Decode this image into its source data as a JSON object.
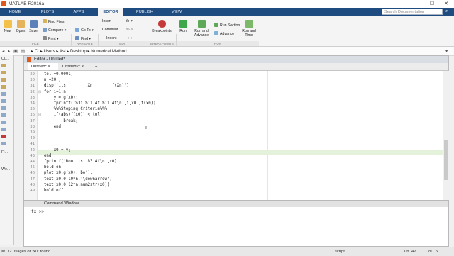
{
  "app": {
    "title": "MATLAB R2016a"
  },
  "window_controls": {
    "minimize": "—",
    "maximize": "☐",
    "close": "✕"
  },
  "tabs": [
    "HOME",
    "PLOTS",
    "APPS",
    "EDITOR",
    "PUBLISH",
    "VIEW"
  ],
  "search": {
    "placeholder": "Search Documentation"
  },
  "ribbon": {
    "new": "New",
    "open": "Open",
    "save": "Save",
    "find_files": "Find Files",
    "compare": "Compare",
    "print": "Print",
    "go_to": "Go To",
    "find": "Find",
    "insert": "Insert",
    "comment": "Comment",
    "indent": "Indent",
    "fx": "fx",
    "breakpoints": "Breakpoints",
    "run": "Run",
    "run_and_advance": "Run and Advance",
    "run_section": "Run Section",
    "advance": "Advance",
    "run_and_time": "Run and Time",
    "groups": [
      "FILE",
      "NAVIGATE",
      "EDIT",
      "BREAKPOINTS",
      "RUN"
    ]
  },
  "address": {
    "crumbs": "▸ C: ▸ Users ▸ Asi ▸ Desktop ▸ Numerical Method"
  },
  "left_pane": {
    "cu": "Cu...",
    "fi": "Fi...",
    "we": "We..."
  },
  "editor": {
    "title": "Editor - Untitled*",
    "tabs": [
      "Untitled* ×",
      "Untitled2* ×",
      "+"
    ],
    "lines": [
      {
        "n": "29",
        "text": "tol =0.0001;"
      },
      {
        "n": "30",
        "text": "n =20 ;"
      },
      {
        "n": "31",
        "text": "disp('its         Xn        f(Xn)')"
      },
      {
        "n": "32",
        "text": "for i=1:n"
      },
      {
        "n": "33",
        "text": "    y = g(x0);"
      },
      {
        "n": "34",
        "text": "    fprintf('%3i %11.4f %11.4f\\n',i,x0 ,f(x0))"
      },
      {
        "n": "35",
        "text": "    %%%Stoping Criteria%%%"
      },
      {
        "n": "36",
        "text": "    if(abs(f(x0)) < tol)"
      },
      {
        "n": "37",
        "text": "        break;"
      },
      {
        "n": "38",
        "text": "    end"
      },
      {
        "n": "39",
        "text": ""
      },
      {
        "n": "40",
        "text": ""
      },
      {
        "n": "41",
        "text": ""
      },
      {
        "n": "42",
        "text": "    x0 = y;"
      },
      {
        "n": "43",
        "text": "end"
      },
      {
        "n": "44",
        "text": "fprintf('Root is: %3.4f\\n',x0)"
      },
      {
        "n": "45",
        "text": "hold on"
      },
      {
        "n": "46",
        "text": "plot(x0,g(x0),'bo');"
      },
      {
        "n": "47",
        "text": "text(x0,0.10*n,'\\downarrow')"
      },
      {
        "n": "48",
        "text": "text(x0,0.12*n,num2str(x0))"
      },
      {
        "n": "49",
        "text": "hold off"
      }
    ],
    "highlight_line": "42"
  },
  "command_window": {
    "title": "Command Window",
    "prompt": "fx >>"
  },
  "status": {
    "left": "12 usages of \"x0\" found",
    "mode": "script",
    "ln_label": "Ln",
    "ln": "42",
    "col_label": "Col",
    "col": "5"
  }
}
